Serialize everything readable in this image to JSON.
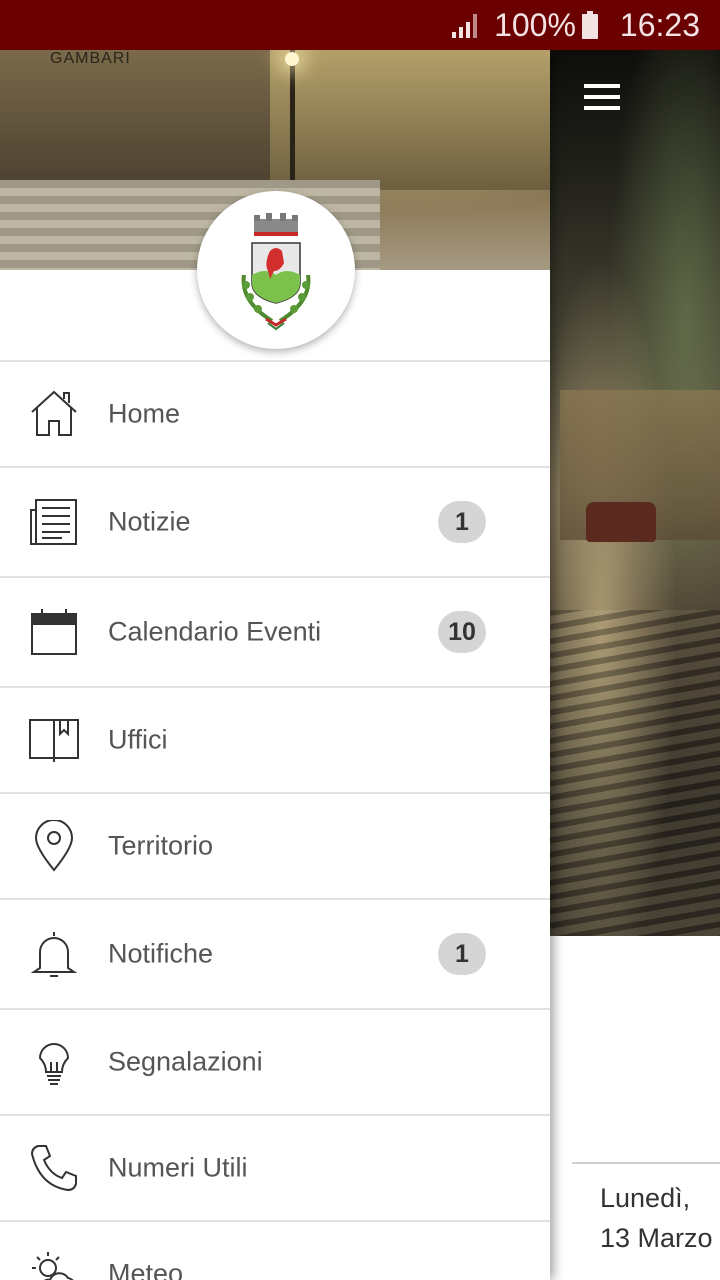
{
  "status_bar": {
    "battery_text": "100%",
    "time": "16:23",
    "color": "#6b0000"
  },
  "drawer": {
    "header_sign": "GAMBARI",
    "menu": [
      {
        "label": "Home",
        "icon": "home-icon",
        "badge": null
      },
      {
        "label": "Notizie",
        "icon": "newspaper-icon",
        "badge": "1"
      },
      {
        "label": "Calendario Eventi",
        "icon": "calendar-icon",
        "badge": "10"
      },
      {
        "label": "Uffici",
        "icon": "book-icon",
        "badge": null
      },
      {
        "label": "Territorio",
        "icon": "map-pin-icon",
        "badge": null
      },
      {
        "label": "Notifiche",
        "icon": "bell-icon",
        "badge": "1"
      },
      {
        "label": "Segnalazioni",
        "icon": "lightbulb-icon",
        "badge": null
      },
      {
        "label": "Numeri Utili",
        "icon": "phone-icon",
        "badge": null
      },
      {
        "label": "Meteo",
        "icon": "weather-icon",
        "badge": null
      }
    ]
  },
  "main": {
    "date_line1": "Lunedì,",
    "date_line2": "13 Marzo"
  }
}
